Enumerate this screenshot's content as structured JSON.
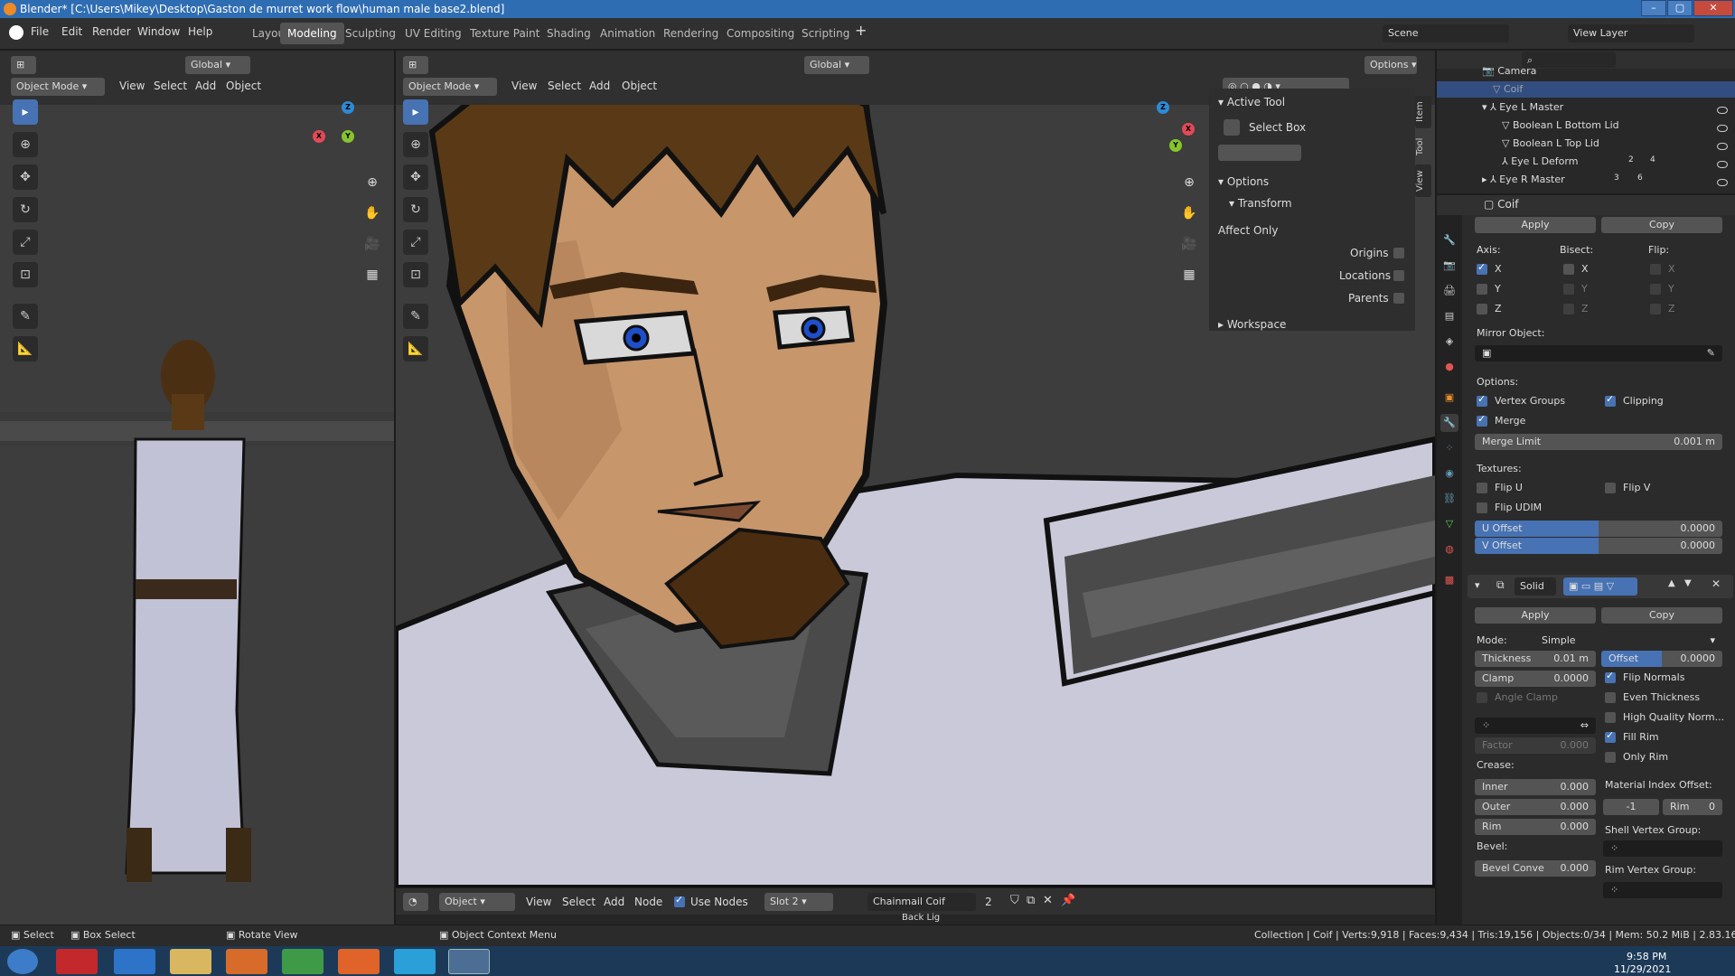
{
  "window": {
    "title": "Blender* [C:\\Users\\Mikey\\Desktop\\Gaston de murret work flow\\human male base2.blend]"
  },
  "menu": [
    "File",
    "Edit",
    "Render",
    "Window",
    "Help"
  ],
  "workspaces": [
    "Layout",
    "Modeling",
    "Sculpting",
    "UV Editing",
    "Texture Paint",
    "Shading",
    "Animation",
    "Rendering",
    "Compositing",
    "Scripting"
  ],
  "active_workspace": "Modeling",
  "scene": "Scene",
  "view_layer": "View Layer",
  "left_vp": {
    "transform": "Global",
    "mode": "Object Mode",
    "menus": [
      "View",
      "Select",
      "Add",
      "Object"
    ]
  },
  "main_vp": {
    "transform": "Global",
    "mode": "Object Mode",
    "menus": [
      "View",
      "Select",
      "Add",
      "Object"
    ],
    "options": "Options"
  },
  "npanel": {
    "active_tool": "Active Tool",
    "select_box": "Select Box",
    "options": "Options",
    "transform": "Transform",
    "affect_only": "Affect Only",
    "origins": "Origins",
    "locations": "Locations",
    "parents": "Parents",
    "workspace": "Workspace",
    "tabs": [
      "Item",
      "Tool",
      "View"
    ]
  },
  "outliner": {
    "items": [
      {
        "label": "Camera"
      },
      {
        "label": "Coif"
      },
      {
        "label": "Eye L Master"
      },
      {
        "label": "Boolean L Bottom Lid"
      },
      {
        "label": "Boolean L Top Lid"
      },
      {
        "label": "Eye L Deform"
      },
      {
        "label": "Eye R Master"
      }
    ],
    "badge_2": "2",
    "badge_4": "4",
    "badge_3": "3",
    "badge_6": "6"
  },
  "props": {
    "object": "Coif",
    "apply": "Apply",
    "copy": "Copy",
    "axis": "Axis:",
    "bisect": "Bisect:",
    "flip": "Flip:",
    "x": "X",
    "y": "Y",
    "z": "Z",
    "mirror_object": "Mirror Object:",
    "options": "Options:",
    "vertex_groups": "Vertex Groups",
    "clipping": "Clipping",
    "merge": "Merge",
    "merge_limit": "Merge Limit",
    "merge_limit_val": "0.001 m",
    "textures": "Textures:",
    "flip_u": "Flip U",
    "flip_v": "Flip V",
    "flip_udim": "Flip UDIM",
    "u_offset": "U Offset",
    "u_offset_val": "0.0000",
    "v_offset": "V Offset",
    "v_offset_val": "0.0000",
    "solid_name": "Solid",
    "mode_label": "Mode:",
    "mode_val": "Simple",
    "thickness": "Thickness",
    "thickness_val": "0.01 m",
    "offset": "Offset",
    "offset_val": "0.0000",
    "clamp": "Clamp",
    "clamp_val": "0.0000",
    "flip_normals": "Flip Normals",
    "angle_clamp": "Angle Clamp",
    "even_thickness": "Even Thickness",
    "hq_norm": "High Quality Norm...",
    "factor": "Factor",
    "factor_val": "0.000",
    "fill_rim": "Fill Rim",
    "only_rim": "Only Rim",
    "crease": "Crease:",
    "mat_index": "Material Index Offset:",
    "inner": "Inner",
    "inner_val": "0.000",
    "outer": "Outer",
    "outer_val": "0.000",
    "rim": "Rim",
    "rim_val": "0.000",
    "mat_a": "-1",
    "mat_b": "Rim",
    "mat_b_val": "0",
    "shell_vg": "Shell Vertex Group:",
    "bevel": "Bevel:",
    "bevel_conv": "Bevel Conve",
    "bevel_conv_val": "0.000",
    "rim_vg": "Rim Vertex Group:"
  },
  "node_hdr": {
    "object": "Object",
    "menus": [
      "View",
      "Select",
      "Add",
      "Node"
    ],
    "use_nodes": "Use Nodes",
    "slot": "Slot 2",
    "material": "Chainmail Coif",
    "users": "2",
    "back_lig": "Back Lig"
  },
  "status": {
    "select": "Select",
    "box_select": "Box Select",
    "rotate": "Rotate View",
    "ctx": "Object Context Menu",
    "stats": "Collection | Coif | Verts:9,918 | Faces:9,434 | Tris:19,156 | Objects:0/34 | Mem: 50.2 MiB | 2.83.16"
  },
  "clock": {
    "time": "9:58 PM",
    "date": "11/29/2021"
  },
  "colors": {
    "accent": "#4772b3",
    "header": "#303030",
    "viewport": "#3d3d3d",
    "skin": "#c7966b",
    "hair": "#5a3a16",
    "shirt": "#c9c9d9"
  }
}
